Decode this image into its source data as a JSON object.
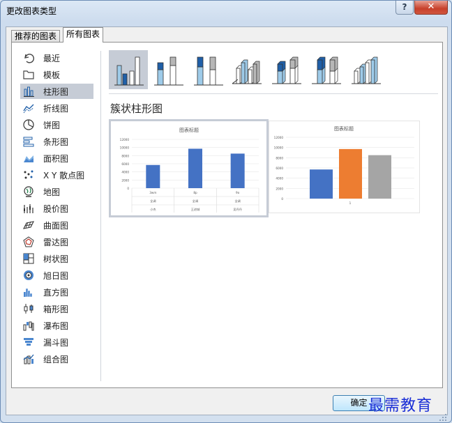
{
  "window": {
    "title": "更改图表类型",
    "help_label": "?",
    "close_label": "✕"
  },
  "tabs": [
    {
      "label": "推荐的图表",
      "active": false
    },
    {
      "label": "所有图表",
      "active": true
    }
  ],
  "categories": [
    {
      "label": "最近",
      "icon": "recent-icon"
    },
    {
      "label": "模板",
      "icon": "folder-icon"
    },
    {
      "label": "柱形图",
      "icon": "column-chart-icon",
      "selected": true
    },
    {
      "label": "折线图",
      "icon": "line-chart-icon"
    },
    {
      "label": "饼图",
      "icon": "pie-chart-icon"
    },
    {
      "label": "条形图",
      "icon": "bar-chart-icon"
    },
    {
      "label": "面积图",
      "icon": "area-chart-icon"
    },
    {
      "label": "X Y 散点图",
      "icon": "scatter-chart-icon"
    },
    {
      "label": "地图",
      "icon": "map-chart-icon"
    },
    {
      "label": "股价图",
      "icon": "stock-chart-icon"
    },
    {
      "label": "曲面图",
      "icon": "surface-chart-icon"
    },
    {
      "label": "雷达图",
      "icon": "radar-chart-icon"
    },
    {
      "label": "树状图",
      "icon": "treemap-chart-icon"
    },
    {
      "label": "旭日图",
      "icon": "sunburst-chart-icon"
    },
    {
      "label": "直方图",
      "icon": "histogram-chart-icon"
    },
    {
      "label": "箱形图",
      "icon": "box-whisker-chart-icon"
    },
    {
      "label": "瀑布图",
      "icon": "waterfall-chart-icon"
    },
    {
      "label": "漏斗图",
      "icon": "funnel-chart-icon"
    },
    {
      "label": "组合图",
      "icon": "combo-chart-icon"
    }
  ],
  "subtype_icons": [
    "clustered-column-icon",
    "stacked-column-icon",
    "100-stacked-column-icon",
    "3d-clustered-column-icon",
    "3d-stacked-column-icon",
    "3d-100-stacked-column-icon",
    "3d-column-icon"
  ],
  "subtype_title": "簇状柱形图",
  "colors": {
    "blue": "#4472c4",
    "orange": "#ed7d31",
    "gray": "#a5a5a5",
    "selected": "#c6ccd6"
  },
  "preview1": {
    "title": "图表标题",
    "yticks": [
      "12000",
      "10000",
      "8000",
      "6000",
      "4000",
      "2000",
      "0"
    ],
    "ylim": [
      0,
      12000
    ],
    "values": [
      5700,
      9700,
      8500
    ],
    "row1": [
      "3wm",
      "8p",
      "9o"
    ],
    "row2": [
      "全调",
      "全调",
      "全调"
    ],
    "row3": [
      "小杰",
      "王进城",
      "吴丹丹"
    ]
  },
  "preview2": {
    "title": "图表标题",
    "yticks": [
      "12000",
      "10000",
      "8000",
      "6000",
      "4000",
      "2000",
      "0"
    ],
    "ylim": [
      0,
      12000
    ],
    "values": [
      5700,
      9700,
      8500
    ],
    "xlabel": "1"
  },
  "buttons": {
    "ok_label": "确定"
  },
  "watermark": "最需教育"
}
